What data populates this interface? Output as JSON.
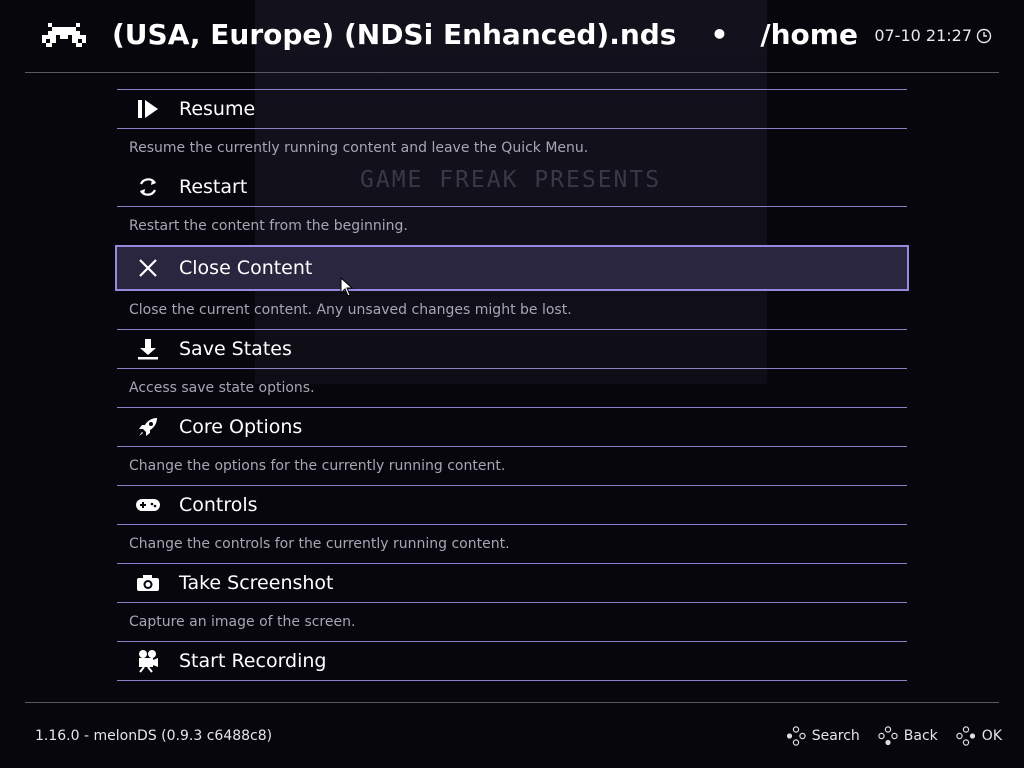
{
  "header": {
    "title_content": "(USA, Europe) (NDSi Enhanced).nds",
    "title_separator": "•",
    "title_path": "/home",
    "datetime": "07-10 21:27"
  },
  "background": {
    "game_text": "GAME FREAK PRESENTS"
  },
  "menu": {
    "items": [
      {
        "label": "Resume",
        "description": "Resume the currently running content and leave the Quick Menu.",
        "icon": "resume-icon"
      },
      {
        "label": "Restart",
        "description": "Restart the content from the beginning.",
        "icon": "restart-icon"
      },
      {
        "label": "Close Content",
        "description": "Close the current content. Any unsaved changes might be lost.",
        "icon": "close-icon",
        "selected": true
      },
      {
        "label": "Save States",
        "description": "Access save state options.",
        "icon": "download-icon"
      },
      {
        "label": "Core Options",
        "description": "Change the options for the currently running content.",
        "icon": "rocket-icon"
      },
      {
        "label": "Controls",
        "description": "Change the controls for the currently running content.",
        "icon": "gamepad-icon"
      },
      {
        "label": "Take Screenshot",
        "description": "Capture an image of the screen.",
        "icon": "camera-icon"
      },
      {
        "label": "Start Recording",
        "description": "",
        "icon": "video-camera-icon"
      }
    ]
  },
  "footer": {
    "version": "1.16.0 - melonDS (0.9.3 c6488c8)",
    "actions": [
      {
        "label": "Search"
      },
      {
        "label": "Back"
      },
      {
        "label": "OK"
      }
    ]
  },
  "colors": {
    "background": "#07060c",
    "divider": "#8b7fc8",
    "selection_border": "#9a88e0",
    "selection_fill": "#2a2640",
    "description_text": "#a8a5b4"
  }
}
